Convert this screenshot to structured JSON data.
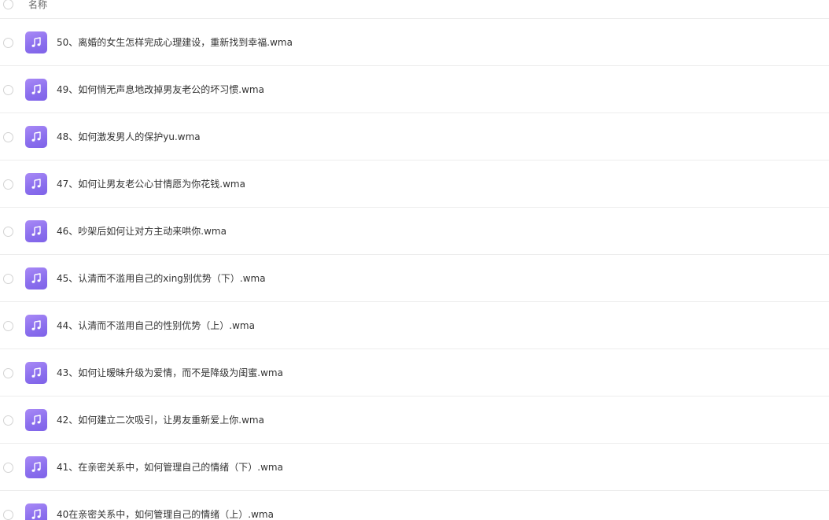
{
  "header": {
    "name_label": "名称"
  },
  "files": [
    {
      "name": "50、离婚的女生怎样完成心理建设，重新找到幸福.wma",
      "icon": "music-file-icon"
    },
    {
      "name": "49、如何悄无声息地改掉男友老公的坏习惯.wma",
      "icon": "music-file-icon"
    },
    {
      "name": "48、如何激发男人的保护yu.wma",
      "icon": "music-file-icon"
    },
    {
      "name": "47、如何让男友老公心甘情愿为你花钱.wma",
      "icon": "music-file-icon"
    },
    {
      "name": "46、吵架后如何让对方主动来哄你.wma",
      "icon": "music-file-icon"
    },
    {
      "name": "45、认清而不滥用自己的xing别优势（下）.wma",
      "icon": "music-file-icon"
    },
    {
      "name": "44、认清而不滥用自己的性别优势（上）.wma",
      "icon": "music-file-icon"
    },
    {
      "name": "43、如何让暧昧升级为爱情，而不是降级为闺蜜.wma",
      "icon": "music-file-icon"
    },
    {
      "name": "42、如何建立二次吸引，让男友重新爱上你.wma",
      "icon": "music-file-icon"
    },
    {
      "name": "41、在亲密关系中，如何管理自己的情绪（下）.wma",
      "icon": "music-file-icon"
    },
    {
      "name": "40在亲密关系中，如何管理自己的情绪（上）.wma",
      "icon": "music-file-icon"
    }
  ],
  "colors": {
    "icon_gradient_start": "#a98af6",
    "icon_gradient_end": "#7e62e8",
    "divider": "#ededed",
    "text": "#333333"
  }
}
